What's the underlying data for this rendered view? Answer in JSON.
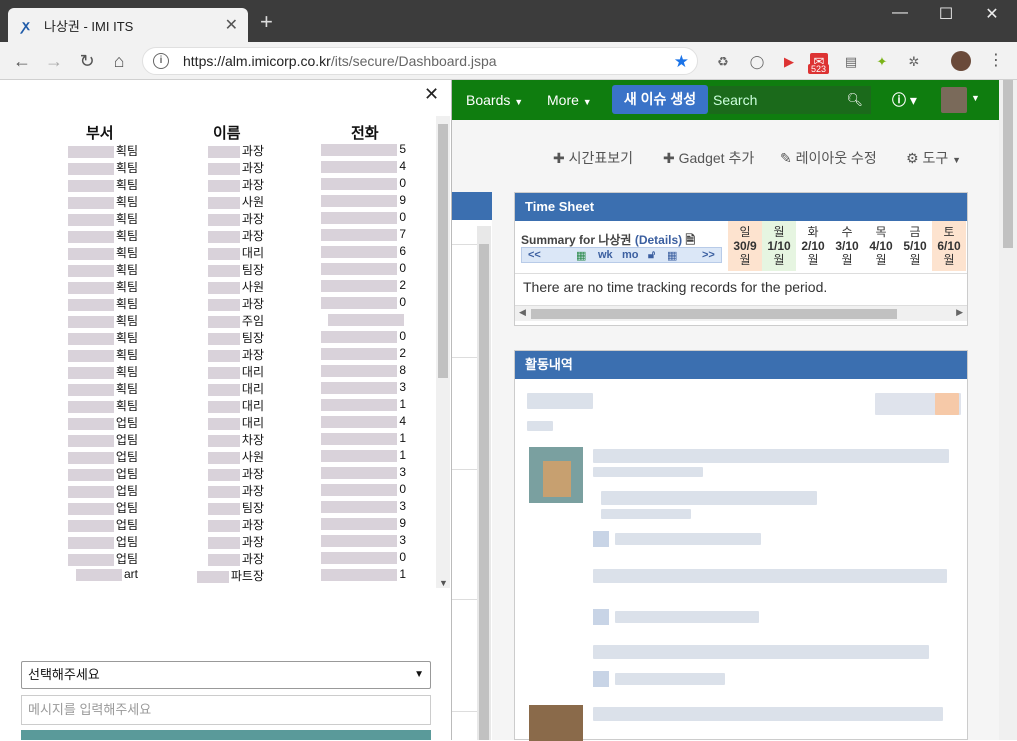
{
  "browser": {
    "tab_title": "나상권 - IMI ITS",
    "url_host": "https://alm.imicorp.co.kr",
    "url_path": "/its/secure/Dashboard.jspa",
    "mail_badge": "523"
  },
  "topnav": {
    "boards": "Boards",
    "more": "More",
    "create": "새 이슈 생성",
    "search_placeholder": "Search"
  },
  "dashboard_actions": {
    "timesheet": "시간표보기",
    "gadget_add": "Gadget 추가",
    "layout_edit": "레이아웃 수정",
    "tools": "도구"
  },
  "timesheet": {
    "title": "Time Sheet",
    "summary_prefix": "Summary for 나상권",
    "details": "(Details)",
    "nav": {
      "prev": "<<",
      "wk": "wk",
      "mo": "mo",
      "next": ">>"
    },
    "days": [
      {
        "d": "일",
        "date": "30/9",
        "m": "월"
      },
      {
        "d": "월",
        "date": "1/10",
        "m": "월"
      },
      {
        "d": "화",
        "date": "2/10",
        "m": "월"
      },
      {
        "d": "수",
        "date": "3/10",
        "m": "월"
      },
      {
        "d": "목",
        "date": "4/10",
        "m": "월"
      },
      {
        "d": "금",
        "date": "5/10",
        "m": "월"
      },
      {
        "d": "토",
        "date": "6/10",
        "m": "월"
      }
    ],
    "empty_message": "There are no time tracking records for the period."
  },
  "activity": {
    "title": "활동내역"
  },
  "directory": {
    "headers": {
      "dept": "부서",
      "name": "이름",
      "phone": "전화"
    },
    "rows": [
      {
        "dept": "획팀",
        "name": "과장",
        "phone": "5"
      },
      {
        "dept": "획팀",
        "name": "과장",
        "phone": "4"
      },
      {
        "dept": "획팀",
        "name": "과장",
        "phone": "0"
      },
      {
        "dept": "획팀",
        "name": "사원",
        "phone": "9"
      },
      {
        "dept": "획팀",
        "name": "과장",
        "phone": "0"
      },
      {
        "dept": "획팀",
        "name": "과장",
        "phone": "7"
      },
      {
        "dept": "획팀",
        "name": "대리",
        "phone": "6"
      },
      {
        "dept": "획팀",
        "name": "팀장",
        "phone": "0"
      },
      {
        "dept": "획팀",
        "name": "사원",
        "phone": "2"
      },
      {
        "dept": "획팀",
        "name": "과장",
        "phone": "0"
      },
      {
        "dept": "획팀",
        "name": "주임",
        "phone": ""
      },
      {
        "dept": "획팀",
        "name": "팀장",
        "phone": "0"
      },
      {
        "dept": "획팀",
        "name": "과장",
        "phone": "2"
      },
      {
        "dept": "획팀",
        "name": "대리",
        "phone": "8"
      },
      {
        "dept": "획팀",
        "name": "대리",
        "phone": "3"
      },
      {
        "dept": "획팀",
        "name": "대리",
        "phone": "1"
      },
      {
        "dept": "업팀",
        "name": "대리",
        "phone": "4"
      },
      {
        "dept": "업팀",
        "name": "차장",
        "phone": "1"
      },
      {
        "dept": "업팀",
        "name": "사원",
        "phone": "1"
      },
      {
        "dept": "업팀",
        "name": "과장",
        "phone": "3"
      },
      {
        "dept": "업팀",
        "name": "과장",
        "phone": "0"
      },
      {
        "dept": "업팀",
        "name": "팀장",
        "phone": "3"
      },
      {
        "dept": "업팀",
        "name": "과장",
        "phone": "9"
      },
      {
        "dept": "업팀",
        "name": "과장",
        "phone": "3"
      },
      {
        "dept": "업팀",
        "name": "과장",
        "phone": "0"
      },
      {
        "dept": "art",
        "name": "파트장",
        "phone": "1"
      }
    ]
  },
  "form": {
    "select_value": "선택해주세요",
    "message_placeholder": "메시지를 입력해주세요"
  }
}
